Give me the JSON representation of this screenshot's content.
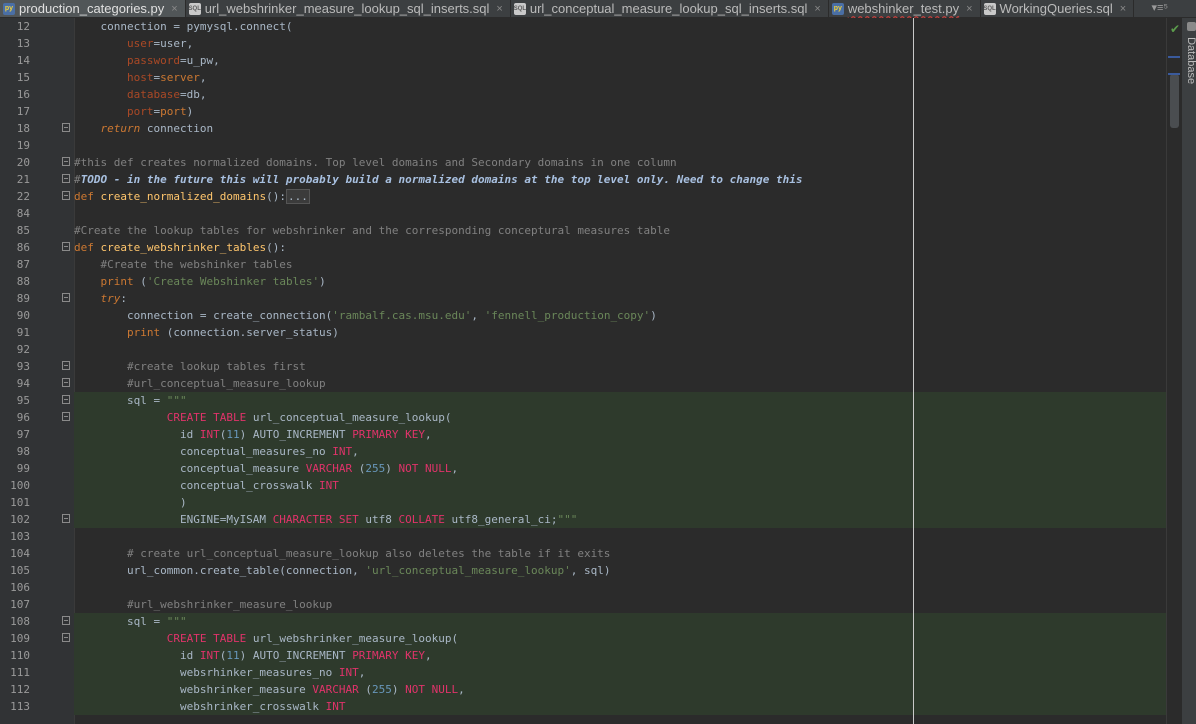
{
  "tabs": [
    {
      "label": "production_categories.py",
      "icon": "python-file-icon",
      "active": true,
      "error": false
    },
    {
      "label": "url_webshrinker_measure_lookup_sql_inserts.sql",
      "icon": "sql-file-icon",
      "active": false,
      "error": false
    },
    {
      "label": "url_conceptual_measure_lookup_sql_inserts.sql",
      "icon": "sql-file-icon",
      "active": false,
      "error": false
    },
    {
      "label": "webshinker_test.py",
      "icon": "python-file-icon",
      "active": false,
      "error": true
    },
    {
      "label": "WorkingQueries.sql",
      "icon": "sql-file-icon",
      "active": false,
      "error": false
    }
  ],
  "tabbar_menu": "▾≡⁵",
  "right_tool_window": "Database",
  "inspection_status": "ok",
  "colors": {
    "keyword": "#cc7832",
    "comment": "#808080",
    "function": "#ffc66d",
    "string": "#6a8759",
    "parameter": "#aa4926",
    "sql_keyword": "#e0336a",
    "number": "#6897bb",
    "injected_sql_background": "#2e3a2c"
  },
  "lines": [
    {
      "n": "12",
      "fold": false,
      "hl": false,
      "t": [
        [
          "    connection ",
          ""
        ],
        [
          "= ",
          ""
        ],
        [
          "pymysql.connect(",
          ""
        ]
      ]
    },
    {
      "n": "13",
      "fold": false,
      "hl": false,
      "t": [
        [
          "        ",
          ""
        ],
        [
          "user",
          "pa"
        ],
        [
          "=user,",
          ""
        ]
      ]
    },
    {
      "n": "14",
      "fold": false,
      "hl": false,
      "t": [
        [
          "        ",
          ""
        ],
        [
          "password",
          "pa"
        ],
        [
          "=u_pw,",
          ""
        ]
      ]
    },
    {
      "n": "15",
      "fold": false,
      "hl": false,
      "t": [
        [
          "        ",
          ""
        ],
        [
          "host",
          "pa"
        ],
        [
          "=",
          ""
        ],
        [
          "server",
          "kw"
        ],
        [
          ",",
          ""
        ]
      ]
    },
    {
      "n": "16",
      "fold": false,
      "hl": false,
      "t": [
        [
          "        ",
          ""
        ],
        [
          "database",
          "pa"
        ],
        [
          "=db,",
          ""
        ]
      ]
    },
    {
      "n": "17",
      "fold": false,
      "hl": false,
      "t": [
        [
          "        ",
          ""
        ],
        [
          "port",
          "pa"
        ],
        [
          "=",
          ""
        ],
        [
          "port",
          "kw"
        ],
        [
          ")",
          ""
        ]
      ]
    },
    {
      "n": "18",
      "fold": true,
      "hl": false,
      "t": [
        [
          "    ",
          ""
        ],
        [
          "return",
          "kwi"
        ],
        [
          " connection",
          ""
        ]
      ]
    },
    {
      "n": "19",
      "fold": false,
      "hl": false,
      "t": []
    },
    {
      "n": "20",
      "fold": true,
      "hl": false,
      "t": [
        [
          "#this def creates normalized domains. Top level domains and Secondary domains in one column",
          "cm"
        ]
      ]
    },
    {
      "n": "21",
      "fold": true,
      "hl": false,
      "t": [
        [
          "#",
          "cm"
        ],
        [
          "TODO - in the future this will probably build a normalized domains at the top level only. Need to change this",
          "todo"
        ]
      ]
    },
    {
      "n": "22",
      "fold": true,
      "hl": false,
      "t": [
        [
          "def ",
          "kw"
        ],
        [
          "create_normalized_domains",
          "fn"
        ],
        [
          "():",
          ""
        ],
        [
          "...",
          "dots"
        ]
      ]
    },
    {
      "n": "84",
      "fold": false,
      "hl": false,
      "t": []
    },
    {
      "n": "85",
      "fold": false,
      "hl": false,
      "t": [
        [
          "#Create the lookup tables for webshrinker and the corresponding conceptural measures table",
          "cm"
        ]
      ]
    },
    {
      "n": "86",
      "fold": true,
      "hl": false,
      "t": [
        [
          "def ",
          "kw"
        ],
        [
          "create_webshrinker_tables",
          "fn"
        ],
        [
          "():",
          ""
        ]
      ]
    },
    {
      "n": "87",
      "fold": false,
      "hl": false,
      "t": [
        [
          "    ",
          ""
        ],
        [
          "#Create the webshinker tables",
          "cm"
        ]
      ]
    },
    {
      "n": "88",
      "fold": false,
      "hl": false,
      "t": [
        [
          "    ",
          ""
        ],
        [
          "print",
          "kw"
        ],
        [
          " (",
          ""
        ],
        [
          "'Create Webshinker tables'",
          "st"
        ],
        [
          ")",
          ""
        ]
      ]
    },
    {
      "n": "89",
      "fold": true,
      "hl": false,
      "t": [
        [
          "    ",
          ""
        ],
        [
          "try",
          "kwi"
        ],
        [
          ":",
          ""
        ]
      ]
    },
    {
      "n": "90",
      "fold": false,
      "hl": false,
      "t": [
        [
          "        connection = create_connection(",
          ""
        ],
        [
          "'rambalf.cas.msu.edu'",
          "st"
        ],
        [
          ", ",
          ""
        ],
        [
          "'fennell_production_copy'",
          "st"
        ],
        [
          ")",
          ""
        ]
      ]
    },
    {
      "n": "91",
      "fold": false,
      "hl": false,
      "t": [
        [
          "        ",
          ""
        ],
        [
          "print",
          "kw"
        ],
        [
          " (connection.server_status)",
          ""
        ]
      ]
    },
    {
      "n": "92",
      "fold": false,
      "hl": false,
      "t": []
    },
    {
      "n": "93",
      "fold": true,
      "hl": false,
      "t": [
        [
          "        ",
          ""
        ],
        [
          "#create lookup tables first",
          "cm"
        ]
      ]
    },
    {
      "n": "94",
      "fold": true,
      "hl": false,
      "t": [
        [
          "        ",
          ""
        ],
        [
          "#url_conceptual_measure_lookup",
          "cm"
        ]
      ]
    },
    {
      "n": "95",
      "fold": true,
      "hl": "start",
      "t": [
        [
          "        sql = ",
          ""
        ],
        [
          "\"\"\"",
          "st"
        ]
      ]
    },
    {
      "n": "96",
      "fold": true,
      "hl": true,
      "t": [
        [
          "              ",
          ""
        ],
        [
          "CREATE TABLE",
          "sq"
        ],
        [
          " url_conceptual_measure_lookup(",
          ""
        ]
      ]
    },
    {
      "n": "97",
      "fold": false,
      "hl": true,
      "t": [
        [
          "                id ",
          ""
        ],
        [
          "INT",
          "sq"
        ],
        [
          "(",
          ""
        ],
        [
          "11",
          "nm"
        ],
        [
          ") AUTO_INCREMENT ",
          ""
        ],
        [
          "PRIMARY KEY",
          "sq"
        ],
        [
          ",",
          ""
        ]
      ]
    },
    {
      "n": "98",
      "fold": false,
      "hl": true,
      "t": [
        [
          "                conceptual_measures_no ",
          ""
        ],
        [
          "INT",
          "sq"
        ],
        [
          ",",
          ""
        ]
      ]
    },
    {
      "n": "99",
      "fold": false,
      "hl": true,
      "t": [
        [
          "                conceptual_measure ",
          ""
        ],
        [
          "VARCHAR",
          "sq"
        ],
        [
          " (",
          ""
        ],
        [
          "255",
          "nm"
        ],
        [
          ") ",
          ""
        ],
        [
          "NOT NULL",
          "sq"
        ],
        [
          ",",
          ""
        ]
      ]
    },
    {
      "n": "100",
      "fold": false,
      "hl": true,
      "t": [
        [
          "                conceptual_crosswalk ",
          ""
        ],
        [
          "INT",
          "sq"
        ]
      ]
    },
    {
      "n": "101",
      "fold": false,
      "hl": true,
      "t": [
        [
          "                )",
          ""
        ]
      ]
    },
    {
      "n": "102",
      "fold": true,
      "hl": true,
      "t": [
        [
          "                ENGINE=MyISAM ",
          ""
        ],
        [
          "CHARACTER SET",
          "sq"
        ],
        [
          " utf8 ",
          ""
        ],
        [
          "COLLATE",
          "sq"
        ],
        [
          " utf8_general_ci;",
          ""
        ],
        [
          "\"\"\"",
          "st"
        ]
      ]
    },
    {
      "n": "103",
      "fold": false,
      "hl": false,
      "t": []
    },
    {
      "n": "104",
      "fold": false,
      "hl": false,
      "t": [
        [
          "        ",
          ""
        ],
        [
          "# create url_conceptual_measure_lookup also deletes the table if it exits",
          "cm"
        ]
      ]
    },
    {
      "n": "105",
      "fold": false,
      "hl": false,
      "t": [
        [
          "        url_common.create_table(connection, ",
          ""
        ],
        [
          "'url_conceptual_measure_lookup'",
          "st"
        ],
        [
          ", sql)",
          ""
        ]
      ]
    },
    {
      "n": "106",
      "fold": false,
      "hl": false,
      "t": []
    },
    {
      "n": "107",
      "fold": false,
      "hl": false,
      "t": [
        [
          "        ",
          ""
        ],
        [
          "#url_webshrinker_measure_lookup",
          "cm"
        ]
      ]
    },
    {
      "n": "108",
      "fold": true,
      "hl": "start",
      "t": [
        [
          "        sql = ",
          ""
        ],
        [
          "\"\"\"",
          "st"
        ]
      ]
    },
    {
      "n": "109",
      "fold": true,
      "hl": true,
      "t": [
        [
          "              ",
          ""
        ],
        [
          "CREATE TABLE",
          "sq"
        ],
        [
          " url_webshrinker_measure_lookup(",
          ""
        ]
      ]
    },
    {
      "n": "110",
      "fold": false,
      "hl": true,
      "t": [
        [
          "                id ",
          ""
        ],
        [
          "INT",
          "sq"
        ],
        [
          "(",
          ""
        ],
        [
          "11",
          "nm"
        ],
        [
          ") AUTO_INCREMENT ",
          ""
        ],
        [
          "PRIMARY KEY",
          "sq"
        ],
        [
          ",",
          ""
        ]
      ]
    },
    {
      "n": "111",
      "fold": false,
      "hl": true,
      "t": [
        [
          "                websrhinker_measures_no ",
          ""
        ],
        [
          "INT",
          "sq"
        ],
        [
          ",",
          ""
        ]
      ]
    },
    {
      "n": "112",
      "fold": false,
      "hl": true,
      "t": [
        [
          "                webshrinker_measure ",
          ""
        ],
        [
          "VARCHAR",
          "sq"
        ],
        [
          " (",
          ""
        ],
        [
          "255",
          "nm"
        ],
        [
          ") ",
          ""
        ],
        [
          "NOT NULL",
          "sq"
        ],
        [
          ",",
          ""
        ]
      ]
    },
    {
      "n": "113",
      "fold": false,
      "hl": true,
      "t": [
        [
          "                webshrinker_crosswalk ",
          ""
        ],
        [
          "INT",
          "sq"
        ]
      ]
    }
  ]
}
